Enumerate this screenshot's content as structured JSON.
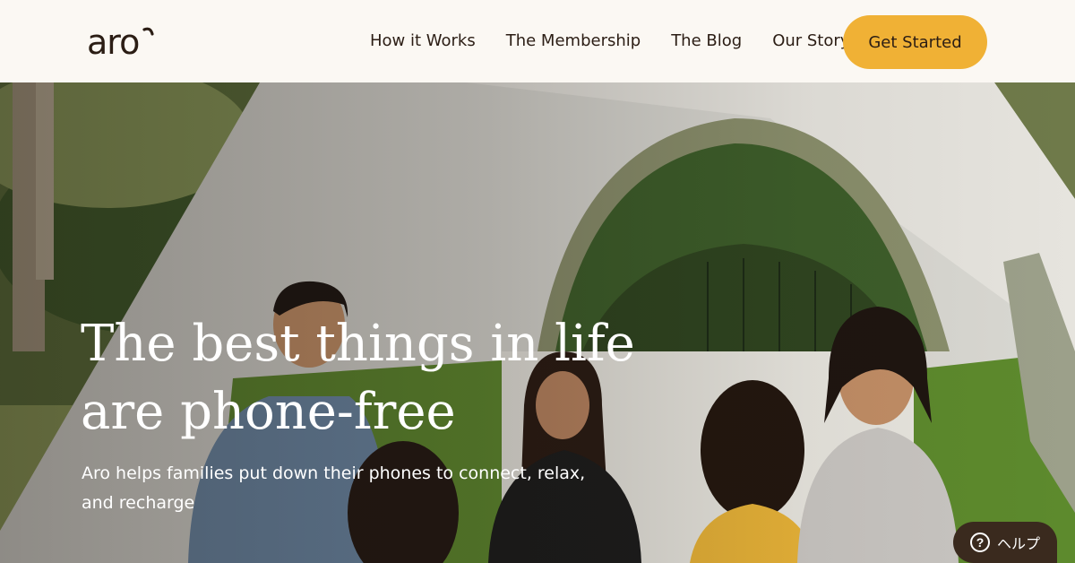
{
  "header": {
    "logo_text": "aro",
    "nav": [
      {
        "label": "How it Works"
      },
      {
        "label": "The Membership"
      },
      {
        "label": "The Blog"
      },
      {
        "label": "Our Story"
      }
    ],
    "cta_label": "Get Started"
  },
  "hero": {
    "title": "The best things in life are phone-free",
    "subtitle": "Aro helps families put down their phones to connect, relax, and recharge"
  },
  "help": {
    "icon": "question-icon",
    "icon_glyph": "?",
    "label": "ヘルプ"
  },
  "colors": {
    "accent": "#f0b135",
    "text_dark": "#2b1d14",
    "header_bg": "#fbf8f3",
    "help_bg": "#3a2a1e"
  }
}
